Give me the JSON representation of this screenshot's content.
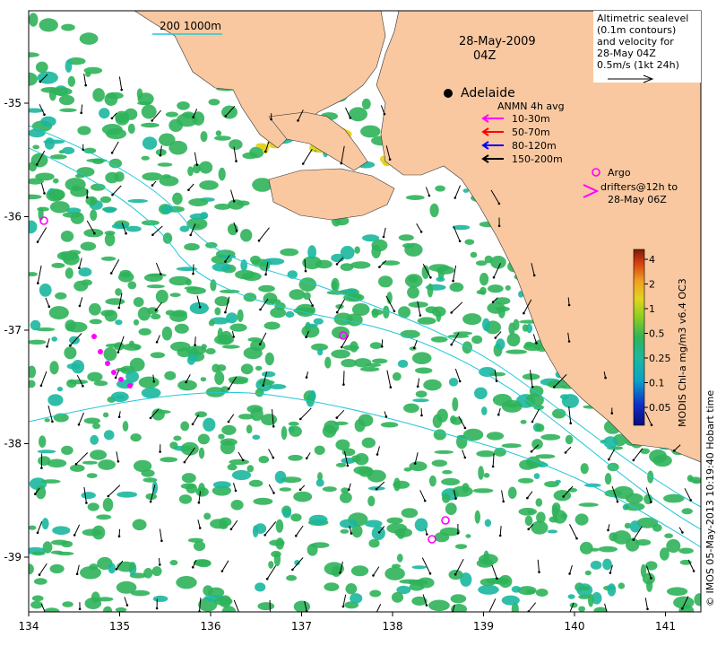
{
  "map": {
    "date_line1": "28-May-2009",
    "date_line2": "04Z",
    "city": "Adelaide",
    "scale_bar_label": "200  1000m",
    "colors": {
      "land": "#f9c8a0",
      "ocean": "#ffffff",
      "chl_green": "#2fb35a",
      "chl_teal": "#1bb7a0",
      "chl_yellow": "#e4d21f",
      "contour": "#22c7d8",
      "arrow": "#000000",
      "argo": "#ff00ff"
    },
    "x_ticks": [
      "134",
      "135",
      "136",
      "137",
      "138",
      "139",
      "140",
      "141"
    ],
    "y_ticks": [
      "-35",
      "-36",
      "-37",
      "-38",
      "-39"
    ]
  },
  "legend_velocity": {
    "line1": "Altimetric sealevel",
    "line2": "(0.1m contours)",
    "line3": "and velocity for",
    "line4": "28-May 04Z",
    "line5": "0.5m/s (1kt 24h)"
  },
  "legend_anmn": {
    "title": "ANMN 4h avg",
    "items": [
      {
        "label": "10-30m",
        "color": "#ff00ff"
      },
      {
        "label": "50-70m",
        "color": "#ff0000"
      },
      {
        "label": "80-120m",
        "color": "#0000ff"
      },
      {
        "label": "150-200m",
        "color": "#000000"
      }
    ]
  },
  "legend_argo": {
    "line1": "Argo",
    "line2": "drifters@12h to",
    "line3": "28-May 06Z"
  },
  "colorbar": {
    "label": "MODIS Chl-a mg/m3 v6.4 OC3",
    "ticks": [
      "4",
      "2",
      "1",
      "0.5",
      "0.25",
      "0.1",
      "0.05"
    ]
  },
  "credit": "© IMOS 05-May-2013 10:19:40 Hobart time"
}
